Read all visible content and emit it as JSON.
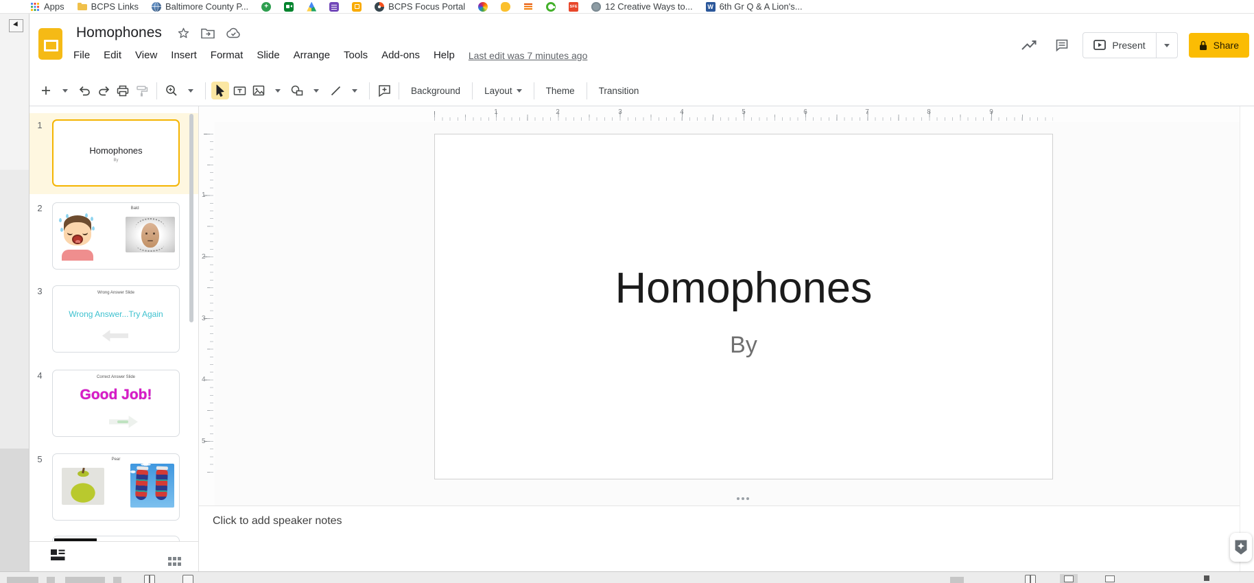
{
  "colors": {
    "brand_yellow": "#f4b400",
    "share_button": "#fbbc04",
    "selected_row_bg": "#fef7e0",
    "wrong_answer_text": "#3ec1cf",
    "good_job_text": "#da1ac6"
  },
  "browser": {
    "bookmarks": [
      {
        "icon": "apps-grid",
        "label": "Apps"
      },
      {
        "icon": "folder",
        "label": "BCPS Links"
      },
      {
        "icon": "globe",
        "label": "Baltimore County P..."
      },
      {
        "icon": "green-badge",
        "label": ""
      },
      {
        "icon": "meet-camera",
        "label": ""
      },
      {
        "icon": "drive-triangle",
        "label": ""
      },
      {
        "icon": "purple-form",
        "label": ""
      },
      {
        "icon": "yellow-tile",
        "label": ""
      },
      {
        "icon": "focus-portal",
        "label": "BCPS Focus Portal"
      },
      {
        "icon": "color-wheel",
        "label": ""
      },
      {
        "icon": "yellow-blob",
        "label": ""
      },
      {
        "icon": "orange-lines",
        "label": ""
      },
      {
        "icon": "green-ring",
        "label": ""
      },
      {
        "icon": "sfe-tile",
        "label": ""
      },
      {
        "icon": "gray-circle",
        "label": "12 Creative Ways to..."
      },
      {
        "icon": "word-doc",
        "label": "6th Gr Q & A Lion's..."
      }
    ],
    "sfe_text": "SFE",
    "word_text": "W"
  },
  "header": {
    "doc_title": "Homophones",
    "menus": [
      "File",
      "Edit",
      "View",
      "Insert",
      "Format",
      "Slide",
      "Arrange",
      "Tools",
      "Add-ons",
      "Help"
    ],
    "last_edit": "Last edit was 7 minutes ago",
    "present_label": "Present",
    "share_label": "Share"
  },
  "toolbar": {
    "background_label": "Background",
    "layout_label": "Layout",
    "theme_label": "Theme",
    "transition_label": "Transition"
  },
  "filmstrip": {
    "slides": [
      {
        "number": "1",
        "title": "Homophones",
        "subtitle": "By"
      },
      {
        "number": "2",
        "caption": "Bald"
      },
      {
        "number": "3",
        "heading": "Wrong Answer Slide",
        "message": "Wrong Answer...Try Again"
      },
      {
        "number": "4",
        "heading": "Correct Answer Slide",
        "message": "Good Job!"
      },
      {
        "number": "5",
        "caption": "Pear"
      }
    ]
  },
  "canvas": {
    "ruler_h": [
      "1",
      "2",
      "3",
      "4",
      "5",
      "6",
      "7",
      "8",
      "9"
    ],
    "ruler_v": [
      "1",
      "2",
      "3",
      "4",
      "5"
    ],
    "slide_title": "Homophones",
    "slide_subtitle": "By",
    "notes_placeholder": "Click to add speaker notes"
  }
}
